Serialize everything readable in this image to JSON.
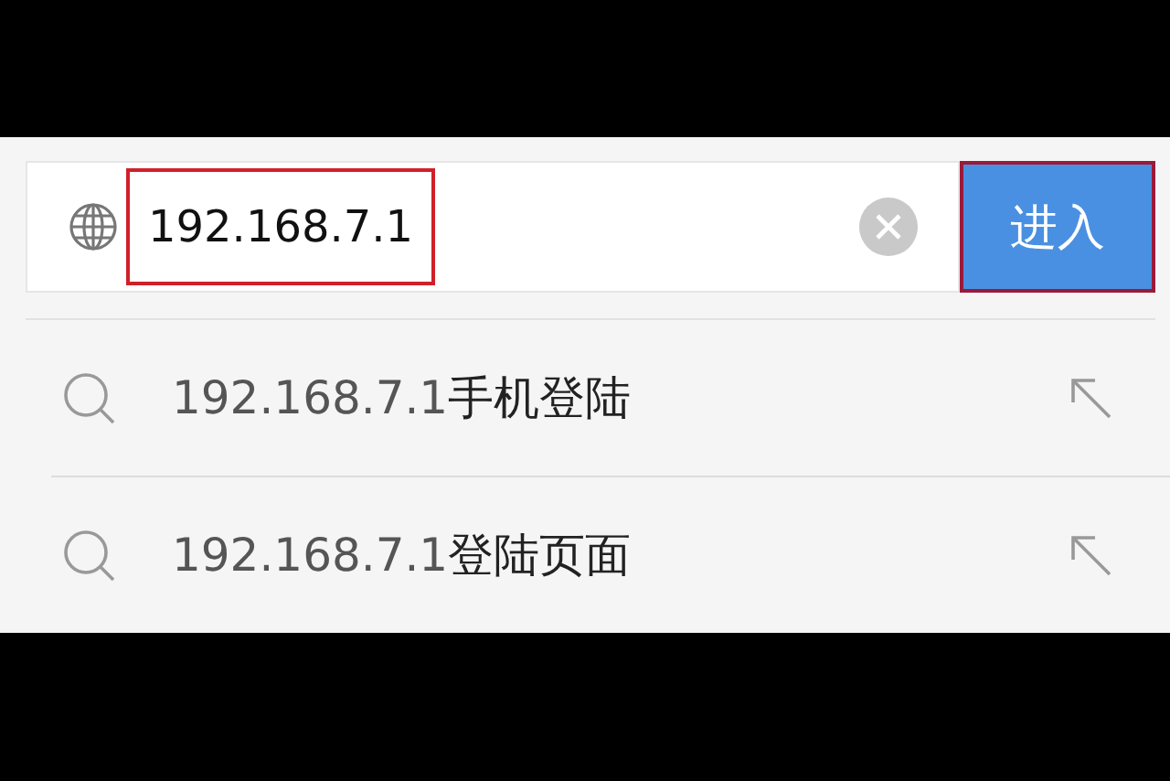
{
  "address_bar": {
    "value": "192.168.7.1",
    "value_highlighted": true,
    "go_button": {
      "label": "进入",
      "highlighted": true
    }
  },
  "suggestions": [
    {
      "query": "192.168.7.1",
      "completion": "手机登陆"
    },
    {
      "query": "192.168.7.1",
      "completion": "登陆页面"
    }
  ]
}
